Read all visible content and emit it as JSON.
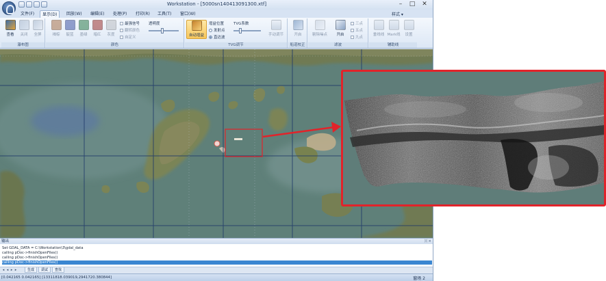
{
  "window": {
    "title": "Workstation - [5000sn140413091300.xtf]",
    "minimize": "–",
    "maximize": "□",
    "close": "✕"
  },
  "tabs": [
    {
      "label": "文件(F)",
      "active": false
    },
    {
      "label": "显示(D)",
      "active": true
    },
    {
      "label": "回放(W)",
      "active": false
    },
    {
      "label": "编辑(E)",
      "active": false
    },
    {
      "label": "处理(P)",
      "active": false
    },
    {
      "label": "打印(R)",
      "active": false
    },
    {
      "label": "工具(T)",
      "active": false
    },
    {
      "label": "窗口(W)",
      "active": false
    }
  ],
  "style_menu": "样式 ▾",
  "ribbon": {
    "groups": {
      "waterfall": "瀑布图",
      "color": "颜色",
      "tvg": "TVG调节",
      "heading": "船道校正",
      "filter": "滤波",
      "aux": "辅助线"
    },
    "buttons": {
      "view": "查看",
      "close": "关闭",
      "fullscreen": "全屏",
      "color1": "褐棕",
      "color2": "靛蓝",
      "color3": "墨绿",
      "color4": "暗红",
      "gray": "灰度",
      "best_signal": "最强信号",
      "invert": "翻转颜色",
      "custom": "自定义",
      "transparency": "透明度",
      "auto_gain": "自动增益",
      "gain_position": "增益位置",
      "emit_point": "发射点",
      "sea_floor": "直达波",
      "tvg_coef": "TVG系数",
      "manual_adjust": "手动调节",
      "heading_open": "开启",
      "remove_noise": "剔除噪点",
      "filter_open": "开启",
      "opt1": "三点",
      "opt2": "五点",
      "opt3": "九点",
      "spaced_lines": "垂线线",
      "mark_lines": "Mark线",
      "settings": "设置"
    }
  },
  "output": {
    "header": "输出",
    "pin": "ᛞ ×",
    "lines": [
      "Set GDAL_DATA = C:\\Workstation\\3\\gdal_data",
      "calling pDoc->finishOpenFiles()",
      "calling pDoc->finishOpenFiles()",
      "calling pDoc->finishOpenFiles()"
    ],
    "selected_line": 3,
    "tabs": [
      "生成",
      "调试",
      "查找"
    ]
  },
  "status": {
    "coords": "[0.042165 0.042165] [13311818.039019,2941720.380844]",
    "page": "窗场 2"
  },
  "colors": {
    "callout_red": "#e2232a",
    "selection_blue": "#3a86d1",
    "sea_green": "#5e7f77"
  }
}
